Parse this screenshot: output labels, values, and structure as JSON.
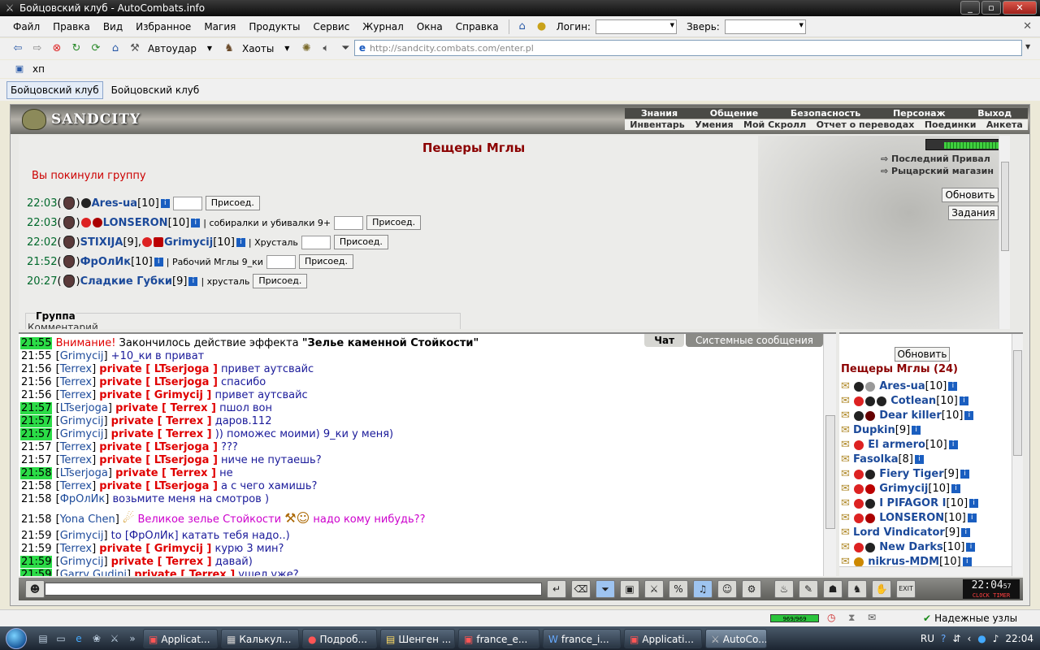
{
  "window": {
    "title": "Бойцовский клуб - AutoCombats.info"
  },
  "menu": {
    "items": [
      "Файл",
      "Правка",
      "Вид",
      "Избранное",
      "Магия",
      "Продукты",
      "Сервис",
      "Журнал",
      "Окна",
      "Справка"
    ],
    "login_label": "Логин:",
    "beast_label": "Зверь:"
  },
  "toolbar": {
    "autoudar": "Автоудар",
    "haoty": "Хаоты",
    "url": "http://sandcity.combats.com/enter.pl"
  },
  "bookmarks": {
    "item": "хп"
  },
  "tabs": [
    "Бойцовский клуб",
    "Бойцовский клуб"
  ],
  "game": {
    "logo": "SANDCITY",
    "nav_top": [
      "Знания",
      "Общение",
      "Безопасность",
      "Персонаж",
      "Выход"
    ],
    "nav_bottom": [
      "Инвентарь",
      "Умения",
      "Мой Скролл",
      "Отчет о переводах",
      "Поединки",
      "Анкета"
    ],
    "location_title": "Пещеры Мглы",
    "left_group_msg": "Вы покинули группу",
    "right_links": [
      "Последний Привал",
      "Рыцарский магазин"
    ],
    "refresh_label": "Обновить",
    "tasks_label": "Задания",
    "join_label": "Присоед.",
    "group_box_label": "Группа",
    "group_box_comment": "Комментарий",
    "groups": [
      {
        "time": "22:03",
        "nick": "Ares-ua",
        "level": "[10]",
        "desc": ""
      },
      {
        "time": "22:03",
        "nick": "LONSERON",
        "level": "[10]",
        "desc": "| собиралки и убивалки 9+"
      },
      {
        "time": "22:02",
        "nick": "STIXIJA",
        "level": "[9]",
        "nick2": "Grimycij",
        "level2": "[10]",
        "desc": "| Хрусталь"
      },
      {
        "time": "21:52",
        "nick": "ФрОлИк",
        "level": "[10]",
        "desc": "| Рабочий Мглы 9_ки"
      },
      {
        "time": "20:27",
        "nick": "Сладкие Губки",
        "level": "[9]",
        "desc": "| хрусталь"
      }
    ]
  },
  "chat": {
    "tabs": [
      "Чат",
      "Системные сообщения"
    ],
    "lines": [
      {
        "time": "21:55",
        "hl": true,
        "pre": "Внимание!",
        "text": " Закончилось действие эффекта ",
        "bold": "\"Зелье каменной Стойкости\""
      },
      {
        "time": "21:55",
        "hl": false,
        "nick": "Grimycij",
        "text": " +10_ки в приват"
      },
      {
        "time": "21:56",
        "hl": false,
        "nick": "Terrex",
        "priv": "private [ LTserjoga ]",
        "text": " привет аутсвайс"
      },
      {
        "time": "21:56",
        "hl": false,
        "nick": "Terrex",
        "priv": "private [ LTserjoga ]",
        "text": " спасибо"
      },
      {
        "time": "21:56",
        "hl": false,
        "nick": "Terrex",
        "priv": "private [ Grimycij ]",
        "text": " привет аутсвайс"
      },
      {
        "time": "21:57",
        "hl": true,
        "nick": "LTserjoga",
        "priv": "private [ Terrex ]",
        "text": " пшол вон"
      },
      {
        "time": "21:57",
        "hl": true,
        "nick": "Grimycij",
        "priv": "private [ Terrex ]",
        "text": " даров.112"
      },
      {
        "time": "21:57",
        "hl": true,
        "nick": "Grimycij",
        "priv": "private [ Terrex ]",
        "text": " )) поможес моими) 9_ки у меня)"
      },
      {
        "time": "21:57",
        "hl": false,
        "nick": "Terrex",
        "priv": "private [ LTserjoga ]",
        "text": " ???"
      },
      {
        "time": "21:57",
        "hl": false,
        "nick": "Terrex",
        "priv": "private [ LTserjoga ]",
        "text": " ниче не путаешь?"
      },
      {
        "time": "21:58",
        "hl": true,
        "nick": "LTserjoga",
        "priv": "private [ Terrex ]",
        "text": " не"
      },
      {
        "time": "21:58",
        "hl": false,
        "nick": "Terrex",
        "priv": "private [ LTserjoga ]",
        "text": " а с чего хамишь?"
      },
      {
        "time": "21:58",
        "hl": false,
        "nick": "ФрОлИк",
        "text": " возьмите меня на смотров )"
      },
      {
        "time": "21:58",
        "hl": false,
        "nick": "Yona Chen",
        "magenta": " Великое зелье Стойкости ",
        "magenta2": " надо кому нибудь??",
        "tall": true
      },
      {
        "time": "21:59",
        "hl": false,
        "nick": "Grimycij",
        "text": " to [ФрОлИк] катать тебя надо..)"
      },
      {
        "time": "21:59",
        "hl": false,
        "nick": "Terrex",
        "priv": "private [ Grimycij ]",
        "text": " курю 3 мин?"
      },
      {
        "time": "21:59",
        "hl": true,
        "nick": "Grimycij",
        "priv": "private [ Terrex ]",
        "text": " давай)"
      },
      {
        "time": "21:59",
        "hl": true,
        "nick": "Garry Gudini",
        "priv": "private [ Terrex ]",
        "text": " ушел уже?"
      }
    ]
  },
  "userlist": {
    "refresh": "Обновить",
    "title": "Пещеры Мглы (24)",
    "users": [
      {
        "nick": "Ares-ua",
        "level": "[10]"
      },
      {
        "nick": "Cotlean",
        "level": "[10]"
      },
      {
        "nick": "Dear killer",
        "level": "[10]"
      },
      {
        "nick": "Dupkin",
        "level": "[9]"
      },
      {
        "nick": "El armero",
        "level": "[10]"
      },
      {
        "nick": "Fasolka",
        "level": "[8]"
      },
      {
        "nick": "Fiery Tiger",
        "level": "[9]"
      },
      {
        "nick": "Grimycij",
        "level": "[10]"
      },
      {
        "nick": "I PIFAGOR I",
        "level": "[10]"
      },
      {
        "nick": "LONSERON",
        "level": "[10]"
      },
      {
        "nick": "Lord Vindicator",
        "level": "[9]"
      },
      {
        "nick": "New Darks",
        "level": "[10]"
      },
      {
        "nick": "nikrus-MDM",
        "level": "[10]"
      }
    ]
  },
  "clock": {
    "time": "22:04",
    "seconds": "57",
    "label": "CLOCK TIMER"
  },
  "statusbar": {
    "hp": "969/969",
    "trusted": "Надежные узлы"
  },
  "taskbar": {
    "tasks": [
      "Applicat...",
      "Калькул...",
      "Подроб...",
      "Шенген ...",
      "france_e...",
      "france_i...",
      "Applicati...",
      "AutoCo..."
    ],
    "lang": "RU",
    "time": "22:04"
  },
  "colors": {
    "accent": "#1c4a9a",
    "private": "#e00000",
    "highlight": "#2bdc47",
    "title": "#8b0000"
  }
}
